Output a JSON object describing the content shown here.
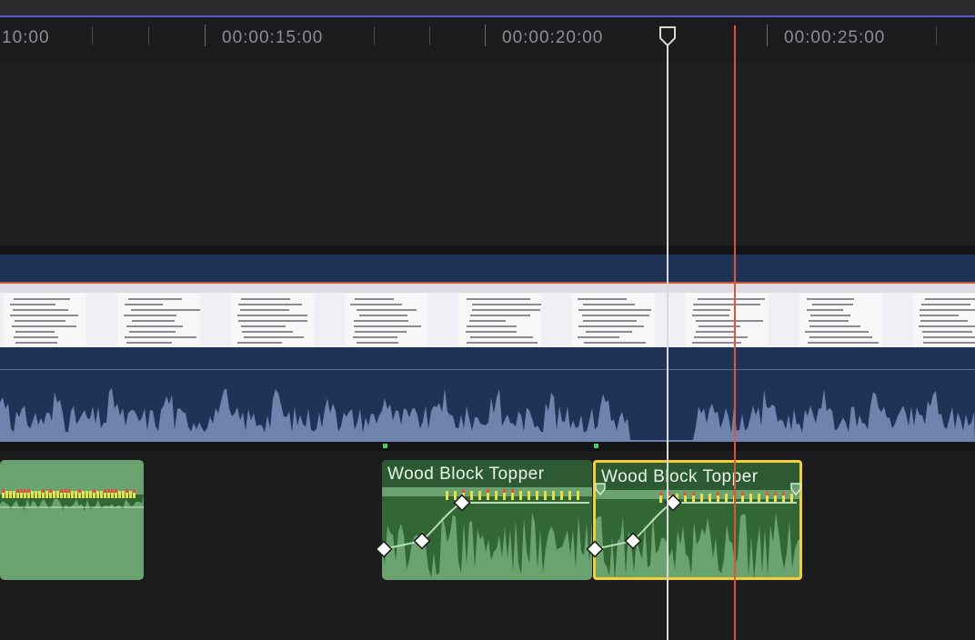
{
  "ruler": {
    "timecodes": [
      "10:00",
      "00:00:15:00",
      "00:00:20:00",
      "00:00:25:00"
    ]
  },
  "clips": [
    {
      "title": "",
      "selected": false
    },
    {
      "title": "Wood Block Topper",
      "selected": false
    },
    {
      "title": "Wood Block Topper",
      "selected": true
    }
  ],
  "colors": {
    "primary_storyline": "#1e3356",
    "audio_clip": "#6aa36f",
    "audio_clip_header": "#2d5a32",
    "selection": "#f2cf3a",
    "playhead": "#e0553a",
    "skimmer": "#d8d8d8",
    "top_accent": "#5a56d8"
  }
}
